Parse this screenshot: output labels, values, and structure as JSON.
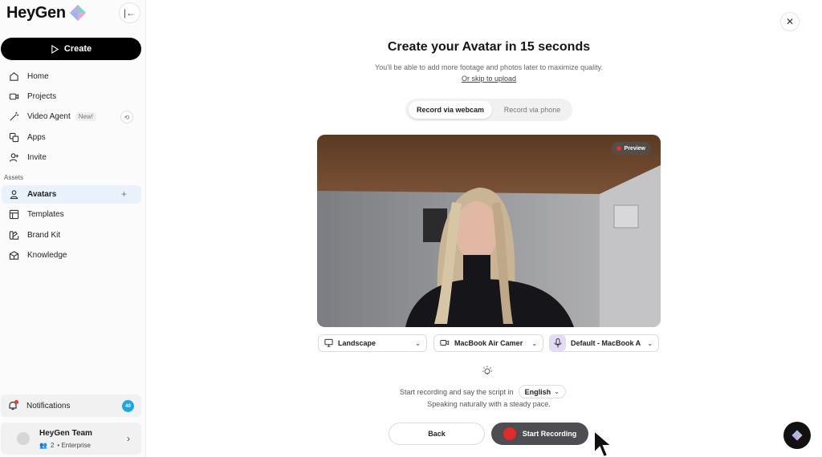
{
  "sidebar": {
    "logo_text": "HeyGen",
    "create_label": "Create",
    "nav_items": [
      {
        "label": "Home",
        "icon": "home-icon"
      },
      {
        "label": "Projects",
        "icon": "video-icon"
      },
      {
        "label": "Video Agent",
        "icon": "wand-icon",
        "badge": "New!"
      },
      {
        "label": "Apps",
        "icon": "apps-icon"
      },
      {
        "label": "Invite",
        "icon": "invite-icon"
      }
    ],
    "assets_label": "Assets",
    "asset_items": [
      {
        "label": "Avatars",
        "icon": "avatar-icon",
        "active": true
      },
      {
        "label": "Templates",
        "icon": "template-icon"
      },
      {
        "label": "Brand Kit",
        "icon": "brand-kit-icon"
      },
      {
        "label": "Knowledge",
        "icon": "knowledge-icon"
      }
    ],
    "notifications_label": "Notifications",
    "notifications_count": "40",
    "team": {
      "name": "HeyGen Team",
      "members": "2",
      "plan": "• Enterprise"
    }
  },
  "main": {
    "title": "Create your Avatar in 15 seconds",
    "subtitle": "You'll be able to add more footage and photos later to maximize quality.",
    "skip_link": "Or skip to upload",
    "record_tabs": [
      "Record via webcam",
      "Record via phone"
    ],
    "active_tab": 0,
    "preview_label": "Preview",
    "selects": {
      "orientation": "Landscape",
      "camera": "MacBook Air Camer",
      "microphone": "Default - MacBook A"
    },
    "instruction_prefix": "Start recording and say the script in",
    "language": "English",
    "instruction_line2": "Speaking naturally with a steady pace.",
    "back_label": "Back",
    "start_label": "Start Recording"
  },
  "colors": {
    "accent": "#1ba7e6",
    "record_red": "#e32b2b",
    "active_nav_bg": "#e9f2fa",
    "create_button": "#000000"
  }
}
